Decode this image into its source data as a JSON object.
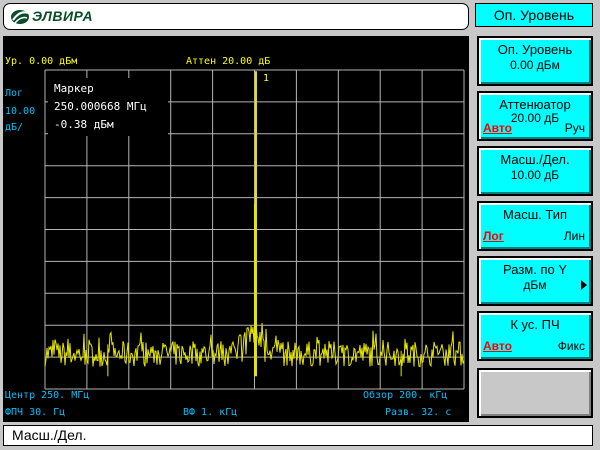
{
  "header": {
    "logo_text": "ЭЛВИРА",
    "logo_icon": "elvira-logo-icon",
    "softkey_menu_title": "Оп. Уровень"
  },
  "screen": {
    "ref_level": "Ур. 0.00 дБм",
    "atten": "Аттен 20.00 дБ",
    "scale_type": "Лог",
    "scale_value": "10.00",
    "scale_unit": "дБ/",
    "marker_number": "1",
    "marker": {
      "title": "Маркер",
      "frequency": "250.000668 МГц",
      "level": "-0.38 дБм"
    },
    "center": "Центр 250. МГц",
    "span": "Обзор 200. кГц",
    "rbw": "ФПЧ 30. Гц",
    "vbw": "ВФ 1. кГц",
    "sweep": "Разв. 32. с"
  },
  "softkeys": [
    {
      "title": "Оп. Уровень",
      "value": "0.00 дБм"
    },
    {
      "title": "Аттенюатор",
      "value": "20.00 дБ",
      "left": "Авто",
      "right": "Руч"
    },
    {
      "title": "Масш./Дел.",
      "value": "10.00 дБ"
    },
    {
      "title": "Масш. Тип",
      "left": "Лог",
      "right": "Лин"
    },
    {
      "title": "Разм. по Y",
      "value": "дБм",
      "arrow": "right-arrow-icon"
    },
    {
      "title": "К ус. ПЧ",
      "left": "Авто",
      "right": "Фикс"
    }
  ],
  "status": "Масш./Дел.",
  "colors": {
    "trace": "#e6e600",
    "grid": "#b4b4b4",
    "softkey": "#00ffff",
    "annotation_yellow": "#ffff00",
    "annotation_cyan": "#00c0ff",
    "auto_red": "#ff0000"
  },
  "chart_data": {
    "type": "line",
    "x_unit": "MHz",
    "y_unit": "dBm",
    "x_range": [
      249.9,
      250.1
    ],
    "ylim": [
      -100,
      0
    ],
    "grid": true,
    "peaks": [
      {
        "x": 250.0007,
        "y": -0.38
      },
      {
        "x": 250.0,
        "y": -42
      },
      {
        "x": 249.93,
        "y": -86
      },
      {
        "x": 250.07,
        "y": -88
      }
    ]
  }
}
